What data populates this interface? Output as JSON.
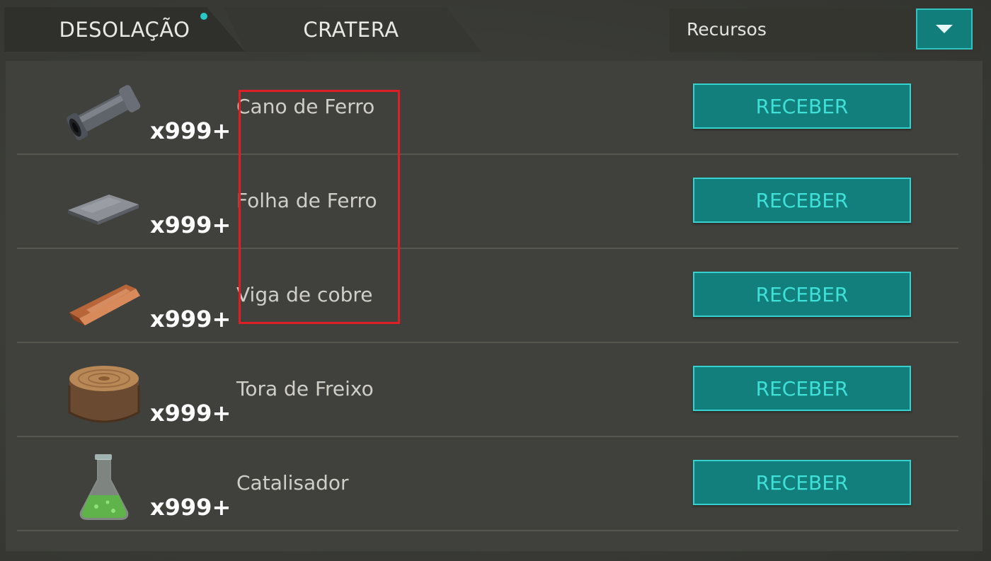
{
  "tabs": [
    {
      "label": "DESOLAÇÃO"
    },
    {
      "label": "CRATERA"
    }
  ],
  "dropdown": {
    "selected": "Recursos"
  },
  "items": [
    {
      "name": "Cano de Ferro",
      "quantity": "x999+",
      "button": "RECEBER",
      "icon": "iron-pipe-icon"
    },
    {
      "name": "Folha de Ferro",
      "quantity": "x999+",
      "button": "RECEBER",
      "icon": "iron-sheet-icon"
    },
    {
      "name": "Viga de cobre",
      "quantity": "x999+",
      "button": "RECEBER",
      "icon": "copper-beam-icon"
    },
    {
      "name": "Tora de Freixo",
      "quantity": "x999+",
      "button": "RECEBER",
      "icon": "ash-log-icon"
    },
    {
      "name": "Catalisador",
      "quantity": "x999+",
      "button": "RECEBER",
      "icon": "catalyst-flask-icon"
    }
  ],
  "colors": {
    "accent": "#127f7c",
    "accent_border": "#36d2cf",
    "highlight": "#e01e26",
    "notification_dot": "#29c7c7"
  }
}
